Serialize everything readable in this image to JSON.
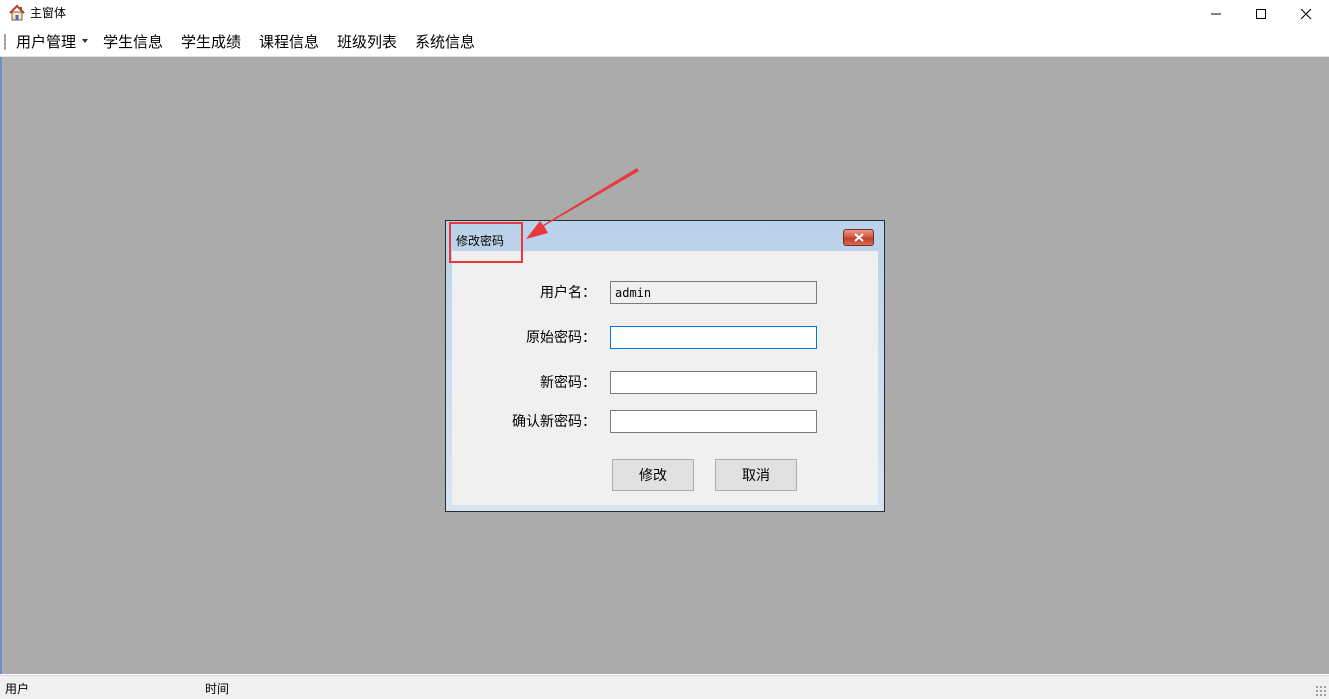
{
  "window": {
    "title": "主窗体",
    "icon": "house-icon"
  },
  "menu": {
    "items": [
      {
        "label": "用户管理",
        "has_dropdown": true
      },
      {
        "label": "学生信息"
      },
      {
        "label": "学生成绩"
      },
      {
        "label": "课程信息"
      },
      {
        "label": "班级列表"
      },
      {
        "label": "系统信息"
      }
    ]
  },
  "dialog": {
    "title": "修改密码",
    "fields": {
      "username": {
        "label": "用户名：",
        "value": "admin"
      },
      "old_password": {
        "label": "原始密码：",
        "value": ""
      },
      "new_password": {
        "label": "新密码：",
        "value": ""
      },
      "confirm_password": {
        "label": "确认新密码：",
        "value": ""
      }
    },
    "buttons": {
      "submit": "修改",
      "cancel": "取消"
    }
  },
  "statusbar": {
    "user_label": "用户",
    "time_label": "时间"
  },
  "colors": {
    "mdi_background": "#ababab",
    "annotation": "#e8393d",
    "focus_border": "#0078d7"
  }
}
